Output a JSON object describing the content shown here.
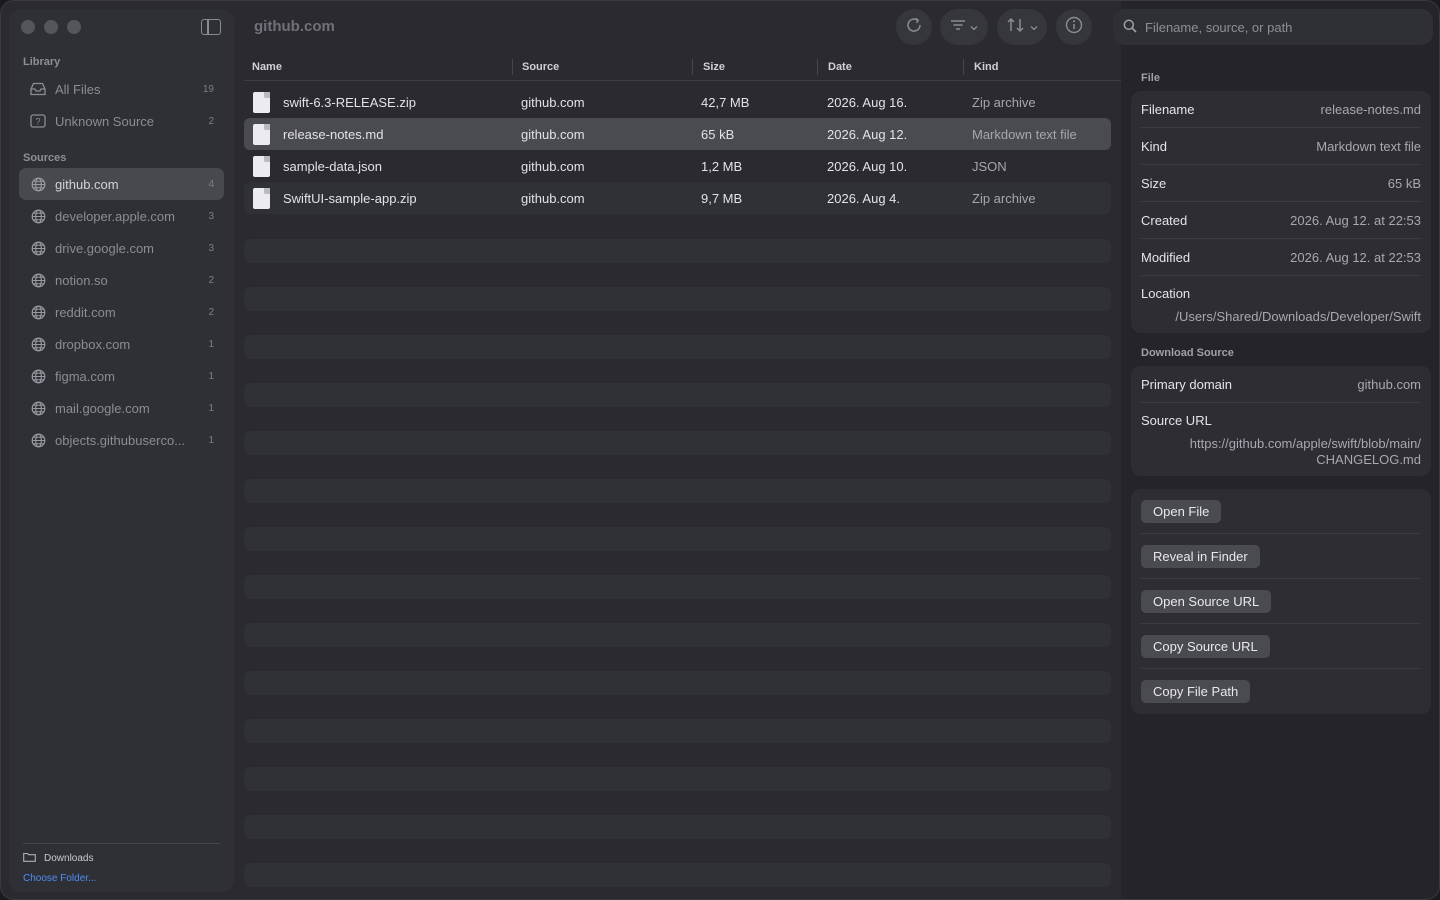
{
  "sidebar": {
    "library_title": "Library",
    "library": [
      {
        "label": "All Files",
        "count": "19",
        "icon": "tray-icon"
      },
      {
        "label": "Unknown Source",
        "count": "2",
        "icon": "unknown-icon"
      }
    ],
    "sources_title": "Sources",
    "sources": [
      {
        "label": "github.com",
        "count": "4"
      },
      {
        "label": "developer.apple.com",
        "count": "3"
      },
      {
        "label": "drive.google.com",
        "count": "3"
      },
      {
        "label": "notion.so",
        "count": "2"
      },
      {
        "label": "reddit.com",
        "count": "2"
      },
      {
        "label": "dropbox.com",
        "count": "1"
      },
      {
        "label": "figma.com",
        "count": "1"
      },
      {
        "label": "mail.google.com",
        "count": "1"
      },
      {
        "label": "objects.githubuserco...",
        "count": "1"
      }
    ],
    "footer": {
      "folder": "Downloads",
      "choose": "Choose Folder..."
    }
  },
  "main": {
    "title": "github.com",
    "columns": {
      "name": "Name",
      "source": "Source",
      "size": "Size",
      "date": "Date",
      "kind": "Kind"
    },
    "rows": [
      {
        "name": "swift-6.3-RELEASE.zip",
        "source": "github.com",
        "size": "42,7 MB",
        "date": "2026. Aug 16.",
        "kind": "Zip archive"
      },
      {
        "name": "release-notes.md",
        "source": "github.com",
        "size": "65 kB",
        "date": "2026. Aug 12.",
        "kind": "Markdown text file"
      },
      {
        "name": "sample-data.json",
        "source": "github.com",
        "size": "1,2 MB",
        "date": "2026. Aug 10.",
        "kind": "JSON"
      },
      {
        "name": "SwiftUI-sample-app.zip",
        "source": "github.com",
        "size": "9,7 MB",
        "date": "2026. Aug 4.",
        "kind": "Zip archive"
      }
    ]
  },
  "inspector": {
    "search_placeholder": "Filename, source, or path",
    "file_section": "File",
    "file": {
      "filename_k": "Filename",
      "filename_v": "release-notes.md",
      "kind_k": "Kind",
      "kind_v": "Markdown text file",
      "size_k": "Size",
      "size_v": "65 kB",
      "created_k": "Created",
      "created_v": "2026. Aug 12. at 22:53",
      "modified_k": "Modified",
      "modified_v": "2026. Aug 12. at 22:53",
      "location_k": "Location",
      "location_v": "/Users/Shared/Downloads/Developer/Swift"
    },
    "source_section": "Download Source",
    "source": {
      "domain_k": "Primary domain",
      "domain_v": "github.com",
      "url_k": "Source URL",
      "url_v1": "https://github.com/apple/swift/blob/main/",
      "url_v2": "CHANGELOG.md"
    },
    "actions": {
      "open_file": "Open File",
      "reveal": "Reveal in Finder",
      "open_url": "Open Source URL",
      "copy_url": "Copy Source URL",
      "copy_path": "Copy File Path"
    }
  }
}
